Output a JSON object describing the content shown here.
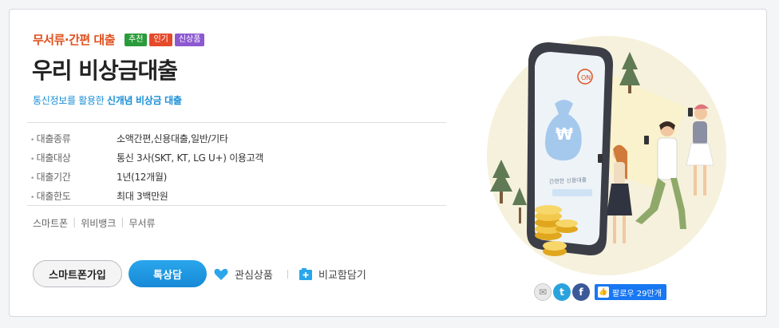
{
  "category": "무서류·간편 대출",
  "badges": [
    "추천",
    "인기",
    "신상품"
  ],
  "product_title": "우리 비상금대출",
  "subtitle_prefix": "통신정보를 활용한 ",
  "subtitle_highlight": "신개념 비상금 대출",
  "info": [
    {
      "key": "대출종류",
      "value": "소액간편,신용대출,일반/기타"
    },
    {
      "key": "대출대상",
      "value": "통신 3사(SKT, KT, LG U+) 이용고객"
    },
    {
      "key": "대출기간",
      "value": "1년(12개월)"
    },
    {
      "key": "대출한도",
      "value": "최대 3백만원"
    }
  ],
  "tags": [
    "스마트폰",
    "위비뱅크",
    "무서류"
  ],
  "buttons": {
    "smartphone_join": "스마트폰가입",
    "consult": "톡상담",
    "favorite": "관심상품",
    "compare": "비교함담기"
  },
  "illustration": {
    "phone_on": "ON",
    "phone_text": "간편한 신용대출"
  },
  "social": {
    "like_label": "팔로우 29만개"
  },
  "colors": {
    "accent_orange": "#e0501d",
    "accent_blue": "#1a8fd6",
    "badge_green": "#2a9b3a",
    "badge_red": "#e54a2a",
    "badge_purple": "#8d59d0"
  }
}
